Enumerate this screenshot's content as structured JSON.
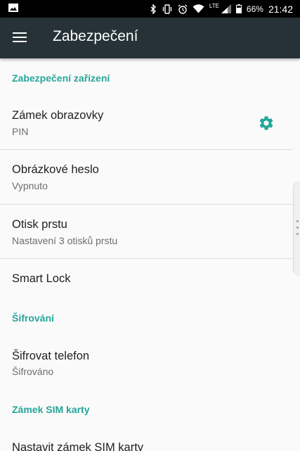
{
  "status_bar": {
    "icons": [
      "image-icon",
      "bluetooth-icon",
      "vibrate-icon",
      "alarm-icon",
      "wifi-icon",
      "signal-icon",
      "battery-icon"
    ],
    "network": "LTE",
    "battery": "66%",
    "time": "21:42"
  },
  "app_bar": {
    "title": "Zabezpečení",
    "background": "#263238"
  },
  "accent_color": "#26a69a",
  "sections": {
    "device_security": "Zabezpečení zařízení",
    "encryption": "Šifrování",
    "sim_lock": "Zámek SIM karty"
  },
  "items": {
    "screen_lock": {
      "title": "Zámek obrazovky",
      "summary": "PIN"
    },
    "picture_password": {
      "title": "Obrázkové heslo",
      "summary": "Vypnuto"
    },
    "fingerprint": {
      "title": "Otisk prstu",
      "summary": "Nastavení 3 otisků prstu"
    },
    "smart_lock": {
      "title": "Smart Lock"
    },
    "encrypt_phone": {
      "title": "Šifrovat telefon",
      "summary": "Šifrováno"
    },
    "set_sim_lock": {
      "title": "Nastavit zámek SIM karty"
    }
  }
}
